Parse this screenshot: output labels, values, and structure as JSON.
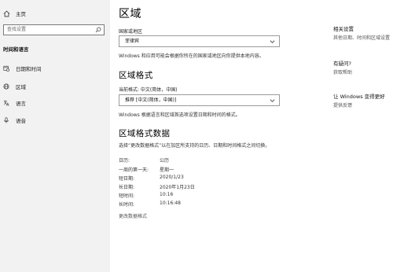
{
  "sidebar": {
    "home_label": "主页",
    "search_placeholder": "查找设置",
    "section_title": "时间和语言",
    "items": [
      {
        "label": "日期和时间",
        "icon": "calendar-clock-icon"
      },
      {
        "label": "区域",
        "icon": "globe-icon"
      },
      {
        "label": "语言",
        "icon": "language-icon"
      },
      {
        "label": "语音",
        "icon": "microphone-icon"
      }
    ]
  },
  "main": {
    "title": "区域",
    "country_label": "国家或地区",
    "country_value": "菲律宾",
    "country_desc": "Windows 和应用可能会根据你所在的国家或地区向你提供本地内容。",
    "format_heading": "区域格式",
    "format_current": "当前格式: 中文(简体，中国)",
    "format_value": "推荐 [中文(简体，中国)]",
    "format_desc": "Windows 根据语言和区域首选项设置日期和时间的格式。",
    "data_heading": "区域格式数据",
    "data_desc": "选择“更改数据格式”以在加区所支持的日历、日期和时间格式之间切换。",
    "data_rows": [
      {
        "key": "日历:",
        "value": "公历"
      },
      {
        "key": "一周的第一天:",
        "value": "星期一"
      },
      {
        "key": "短日期:",
        "value": "2020/1/23"
      },
      {
        "key": "长日期:",
        "value": "2020年1月23日"
      },
      {
        "key": "短时间:",
        "value": "10:16"
      },
      {
        "key": "长时间:",
        "value": "10:16:48"
      }
    ],
    "change_format_link": "更改数据格式"
  },
  "related": {
    "related_heading": "相关设置",
    "related_link": "其他日期、时间和区域设置",
    "help_heading": "有疑问?",
    "help_link": "获取帮助",
    "improve_heading": "让 Windows 变得更好",
    "improve_link": "提供反馈"
  }
}
